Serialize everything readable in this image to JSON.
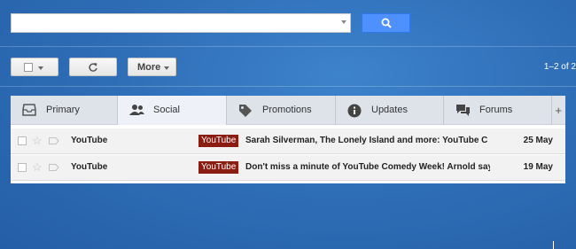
{
  "search": {
    "value": "",
    "placeholder": ""
  },
  "icons": {
    "search": "search-icon",
    "refresh": "refresh-icon"
  },
  "toolbar": {
    "more_label": "More"
  },
  "pager": {
    "text": "1–2 of 2"
  },
  "tabs": [
    {
      "label": "Primary",
      "icon": "inbox-icon",
      "active": false
    },
    {
      "label": "Social",
      "icon": "people-icon",
      "active": true
    },
    {
      "label": "Promotions",
      "icon": "tag-icon",
      "active": false
    },
    {
      "label": "Updates",
      "icon": "info-icon",
      "active": false
    },
    {
      "label": "Forums",
      "icon": "forum-icon",
      "active": false
    }
  ],
  "add_tab_label": "+",
  "emails": [
    {
      "sender": "YouTube",
      "label": "YouTube",
      "subject": "Sarah Silverman, The Lonely Island and more: YouTube C",
      "date": "25 May"
    },
    {
      "sender": "YouTube",
      "label": "YouTube",
      "subject": "Don't miss a minute of YouTube Comedy Week! Arnold say",
      "date": "19 May"
    }
  ],
  "colors": {
    "search_button": "#4d90fe",
    "label_bg": "#8a1c12",
    "background": "#2f6fb8"
  }
}
